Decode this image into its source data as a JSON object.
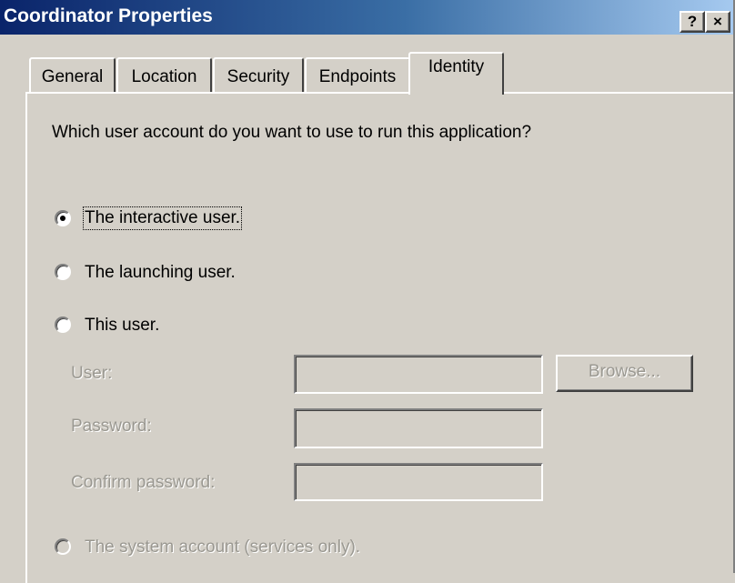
{
  "window": {
    "title": "Coordinator Properties",
    "help_button": "?",
    "close_button": "×"
  },
  "tabs": [
    {
      "label": "General",
      "active": false
    },
    {
      "label": "Location",
      "active": false
    },
    {
      "label": "Security",
      "active": false
    },
    {
      "label": "Endpoints",
      "active": false
    },
    {
      "label": "Identity",
      "active": true
    }
  ],
  "identity": {
    "question": "Which user account do you want to use to run this application?",
    "options": {
      "interactive_user": {
        "label": "The interactive user.",
        "selected": true,
        "enabled": true
      },
      "launching_user": {
        "label": "The launching user.",
        "selected": false,
        "enabled": true
      },
      "this_user": {
        "label": "This user.",
        "selected": false,
        "enabled": true
      },
      "system_account": {
        "label": "The system account (services only).",
        "selected": false,
        "enabled": false
      }
    },
    "fields": {
      "user_label": "User:",
      "user_value": "",
      "password_label": "Password:",
      "password_value": "",
      "confirm_password_label": "Confirm password:",
      "confirm_password_value": ""
    },
    "browse_button": "Browse..."
  }
}
